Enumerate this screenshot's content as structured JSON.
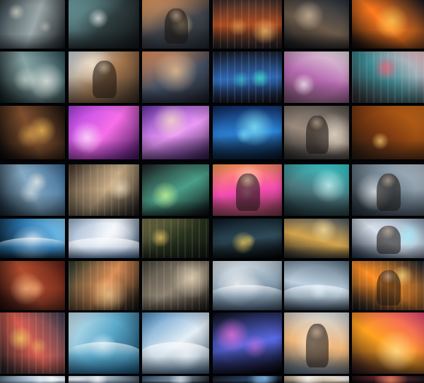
{
  "gallery": {
    "theme": "grid of AI-generated image thumbnails",
    "background_color": "#07090d",
    "tiles": [
      {
        "name": "tile-misty-harbor",
        "colors": [
          "#35434a",
          "#9aa7a8",
          "#10161a"
        ],
        "accent": "#d7d2c4"
      },
      {
        "name": "tile-wave-city",
        "colors": [
          "#7bb2b7",
          "#2e3c3e",
          "#0e1213"
        ],
        "accent": "#eef2ef"
      },
      {
        "name": "tile-sunlit-figure",
        "colors": [
          "#f5a565",
          "#40444c",
          "#1b2026"
        ],
        "accent": "#ffe2a6"
      },
      {
        "name": "tile-neon-streets",
        "colors": [
          "#3e2d2a",
          "#b04d20",
          "#151518"
        ],
        "accent": "#ffc46b"
      },
      {
        "name": "tile-figure-on-couch",
        "colors": [
          "#27303b",
          "#6b5a4a",
          "#0c0e12"
        ],
        "accent": "#d7c0a2"
      },
      {
        "name": "tile-fireball",
        "colors": [
          "#1a1a21",
          "#ff7a1e",
          "#06070a"
        ],
        "accent": "#ffd25a"
      },
      {
        "name": "tile-storm-lighthouse",
        "colors": [
          "#2e4f57",
          "#86a4a4",
          "#0c1416"
        ],
        "accent": "#f0f0e8"
      },
      {
        "name": "tile-trumpet-player",
        "colors": [
          "#d4e3ec",
          "#a97b51",
          "#2a221c"
        ],
        "accent": "#fff1dc"
      },
      {
        "name": "tile-dusk-mountains",
        "colors": [
          "#ec9560",
          "#434f63",
          "#14161c"
        ],
        "accent": "#ffd09a"
      },
      {
        "name": "tile-cyber-night",
        "colors": [
          "#151721",
          "#2f69b5",
          "#0d0c13"
        ],
        "accent": "#3cf0c7"
      },
      {
        "name": "tile-sleeping-on-desk",
        "colors": [
          "#ece2e7",
          "#b66ab0",
          "#5c3d55"
        ],
        "accent": "#fff7fb"
      },
      {
        "name": "tile-comic-panels",
        "colors": [
          "#ffcfd8",
          "#3b8b93",
          "#211b1e"
        ],
        "accent": "#ff5b71"
      },
      {
        "name": "tile-glowing-machine",
        "colors": [
          "#17110e",
          "#7e4e2d",
          "#050506"
        ],
        "accent": "#ffc75c"
      },
      {
        "name": "tile-magenta-orb",
        "colors": [
          "#ad44e4",
          "#f76ee8",
          "#36104d"
        ],
        "accent": "#fff0ff"
      },
      {
        "name": "tile-cloud-trail",
        "colors": [
          "#6a34ac",
          "#ec99f7",
          "#221338"
        ],
        "accent": "#ffe9c6"
      },
      {
        "name": "tile-blue-nebula",
        "colors": [
          "#0f2456",
          "#2d84d9",
          "#06101f"
        ],
        "accent": "#8ff6ff"
      },
      {
        "name": "tile-market-shelves",
        "colors": [
          "#544f4a",
          "#9a8a7d",
          "#1c1c1e"
        ],
        "accent": "#efe4d4"
      },
      {
        "name": "tile-desert-spire",
        "colors": [
          "#d26f18",
          "#7e3b11",
          "#1d140e"
        ],
        "accent": "#ffd071"
      },
      {
        "name": "tile-pianist",
        "colors": [
          "#3c6a93",
          "#85aac4",
          "#101b25"
        ],
        "accent": "#f7f4ea"
      },
      {
        "name": "tile-library",
        "colors": [
          "#3f332b",
          "#c7ab84",
          "#111111"
        ],
        "accent": "#f4e1c1"
      },
      {
        "name": "tile-floating-plants",
        "colors": [
          "#1d1f22",
          "#4b9f88",
          "#07080a"
        ],
        "accent": "#d3ff94"
      },
      {
        "name": "tile-portrait-pink",
        "colors": [
          "#ff9f55",
          "#f44db1",
          "#5e2c38"
        ],
        "accent": "#ffe0c5"
      },
      {
        "name": "tile-cyan-room",
        "colors": [
          "#37d1d3",
          "#4c7a80",
          "#121e21"
        ],
        "accent": "#d8ffff"
      },
      {
        "name": "tile-portrait-grey",
        "colors": [
          "#bdcad7",
          "#687a87",
          "#1a2028"
        ],
        "accent": "#f5f6f8"
      },
      {
        "name": "tile-sea-eclipse",
        "colors": [
          "#8ad5ff",
          "#2c78b0",
          "#08131f"
        ],
        "accent": "#ffffff"
      },
      {
        "name": "tile-snowy-range",
        "colors": [
          "#9eb4cf",
          "#e9eff7",
          "#2a4360"
        ],
        "accent": "#ffffff"
      },
      {
        "name": "tile-forest-lodge",
        "colors": [
          "#7a7548",
          "#27311d",
          "#0d100c"
        ],
        "accent": "#ffd26b"
      },
      {
        "name": "tile-portal-sphere",
        "colors": [
          "#0c1722",
          "#2f4b59",
          "#030507"
        ],
        "accent": "#ffd45b"
      },
      {
        "name": "tile-golden-field",
        "colors": [
          "#4f5a64",
          "#d3a44d",
          "#191b1e"
        ],
        "accent": "#ffe5a2"
      },
      {
        "name": "tile-particle-woman",
        "colors": [
          "#8fa3b9",
          "#d8e0ea",
          "#192433"
        ],
        "accent": "#a6f0ff"
      },
      {
        "name": "tile-red-dining-room",
        "colors": [
          "#5b1d14",
          "#b14d2e",
          "#180808"
        ],
        "accent": "#ffbf87"
      },
      {
        "name": "tile-crowd-lights",
        "colors": [
          "#26352a",
          "#dc8e55",
          "#0b0e0d"
        ],
        "accent": "#ffd495"
      },
      {
        "name": "tile-storefront",
        "colors": [
          "#4a473d",
          "#8d8170",
          "#15130f"
        ],
        "accent": "#f2dfbf"
      },
      {
        "name": "tile-ocean-horizon",
        "colors": [
          "#dce5ec",
          "#8ca2b4",
          "#293847"
        ],
        "accent": "#ffffff"
      },
      {
        "name": "tile-foam-waves",
        "colors": [
          "#5b7082",
          "#bfd2e1",
          "#1d2834"
        ],
        "accent": "#f5fbff"
      },
      {
        "name": "tile-burning-houses",
        "colors": [
          "#15202e",
          "#ff8f24",
          "#090d13"
        ],
        "accent": "#ffe180"
      },
      {
        "name": "tile-quilt-grid",
        "colors": [
          "#3b3f54",
          "#d85d4f",
          "#14151a"
        ],
        "accent": "#f3d65f"
      },
      {
        "name": "tile-giant-wave",
        "colors": [
          "#d4edf7",
          "#5aa8c9",
          "#0f3550"
        ],
        "accent": "#ffffff"
      },
      {
        "name": "tile-mountain-climber",
        "colors": [
          "#4d8ec4",
          "#e4eff7",
          "#263c4f"
        ],
        "accent": "#ffffff"
      },
      {
        "name": "tile-cosmic-ring",
        "colors": [
          "#090b12",
          "#5a6ae4",
          "#020204"
        ],
        "accent": "#ff75e1"
      },
      {
        "name": "tile-smiling-girl",
        "colors": [
          "#d0dce6",
          "#f0b779",
          "#39495a"
        ],
        "accent": "#fff0e1"
      },
      {
        "name": "tile-inferno-cave",
        "colors": [
          "#f04c7d",
          "#ffa21e",
          "#1a0d16"
        ],
        "accent": "#ffe3a1"
      },
      {
        "name": "tile-bottom-partial-1",
        "colors": [
          "#e6eef5",
          "#b7c9d8",
          "#4f6274"
        ],
        "accent": "#ffffff"
      },
      {
        "name": "tile-bottom-partial-2",
        "colors": [
          "#e9edf2",
          "#9eb1c1",
          "#3b4a57"
        ],
        "accent": "#ffffff"
      },
      {
        "name": "tile-bottom-partial-3",
        "colors": [
          "#31475d",
          "#7a8fa2",
          "#11171c"
        ],
        "accent": "#d9e6f2"
      },
      {
        "name": "tile-bottom-partial-4",
        "colors": [
          "#14151b",
          "#28405f",
          "#06070a"
        ],
        "accent": "#8ecbff"
      },
      {
        "name": "tile-bottom-partial-5",
        "colors": [
          "#f4f2ee",
          "#c7b8a5",
          "#6b5f53"
        ],
        "accent": "#ffffff"
      },
      {
        "name": "tile-bottom-partial-6",
        "colors": [
          "#15151a",
          "#6c2731",
          "#060608"
        ],
        "accent": "#ff8f67"
      }
    ]
  }
}
